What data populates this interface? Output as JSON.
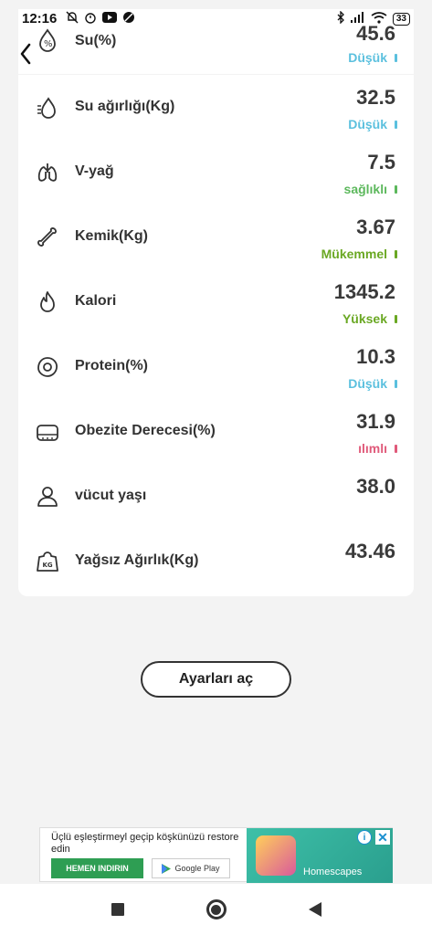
{
  "status_bar": {
    "time": "12:16",
    "left_icons": [
      "bell-off-icon",
      "alarm-icon",
      "youtube-icon",
      "circle-slash-icon"
    ],
    "right_icons": [
      "bluetooth-icon",
      "signal-icon",
      "wifi-icon"
    ],
    "battery": "33"
  },
  "metrics": [
    {
      "icon": "water-drop-percent-icon",
      "label": "Su(%)",
      "value": "45.6",
      "status": "Düşük",
      "status_color": "#5bc0de"
    },
    {
      "icon": "water-weight-icon",
      "label": "Su ağırlığı(Kg)",
      "value": "32.5",
      "status": "Düşük",
      "status_color": "#5bc0de"
    },
    {
      "icon": "lungs-icon",
      "label": "V-yağ",
      "value": "7.5",
      "status": "sağlıklı",
      "status_color": "#5cb85c"
    },
    {
      "icon": "bone-icon",
      "label": "Kemik(Kg)",
      "value": "3.67",
      "status": "Mükemmel",
      "status_color": "#6aa823"
    },
    {
      "icon": "flame-icon",
      "label": "Kalori",
      "value": "1345.2",
      "status": "Yüksek",
      "status_color": "#6aa823"
    },
    {
      "icon": "egg-icon",
      "label": "Protein(%)",
      "value": "10.3",
      "status": "Düşük",
      "status_color": "#5bc0de"
    },
    {
      "icon": "obesity-icon",
      "label": "Obezite Derecesi(%)",
      "value": "31.9",
      "status": "ılımlı",
      "status_color": "#e05a7a"
    },
    {
      "icon": "person-icon",
      "label": "vücut yaşı",
      "value": "38.0",
      "status": "",
      "status_color": ""
    },
    {
      "icon": "kg-weight-icon",
      "label": "Yağsız Ağırlık(Kg)",
      "value": "43.46",
      "status": "",
      "status_color": ""
    }
  ],
  "settings_button": "Ayarları aç",
  "ad": {
    "text": "Üçlü eşleştirmeyl geçip köşkünüzü restore edin",
    "install": "HEMEN INDIRIN",
    "store": "Google Play",
    "game_name": "Homescapes"
  },
  "colors": {
    "low": "#5bc0de",
    "healthy": "#5cb85c",
    "excellent": "#6aa823",
    "moderate": "#e05a7a"
  }
}
